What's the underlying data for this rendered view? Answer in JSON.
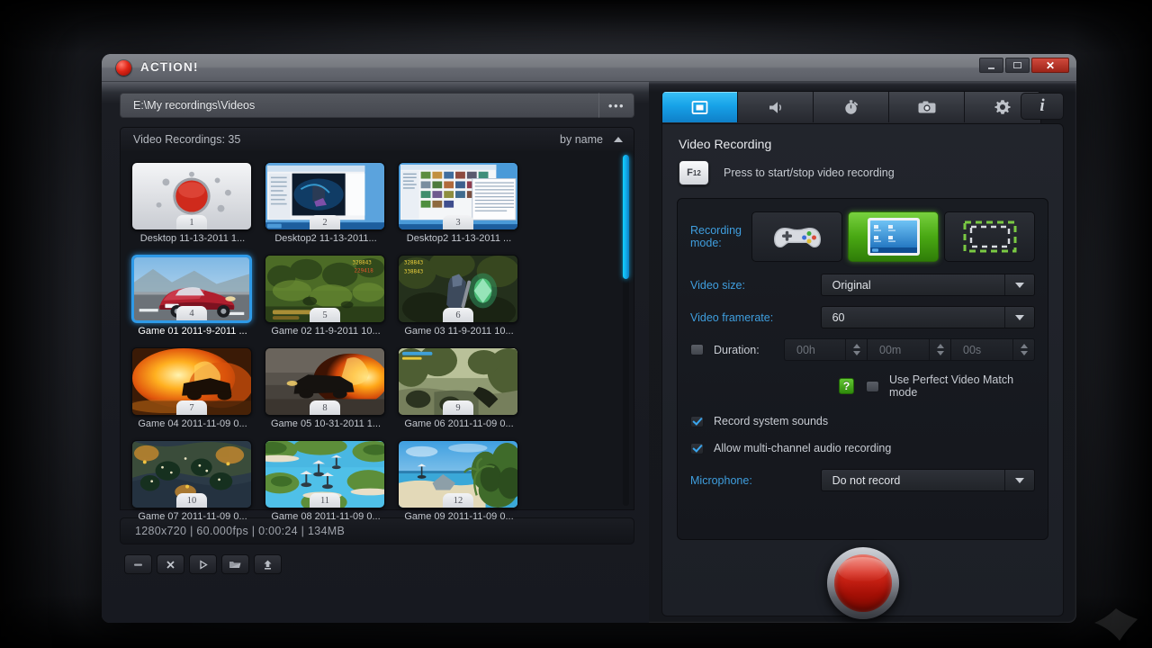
{
  "window": {
    "title": "ACTION!",
    "logo_icon": "record-dot-icon",
    "controls": {
      "minimize": "minimize-icon",
      "maximize": "maximize-icon",
      "close": "✕"
    }
  },
  "left": {
    "path": {
      "value": "E:\\My recordings\\Videos",
      "browse_label": "•••"
    },
    "list_header": {
      "title": "Video Recordings: 35",
      "sort": "by name",
      "sort_dir_icon": "chevron-up-icon"
    },
    "thumbnails": [
      {
        "num": "1",
        "label": "Desktop 11-13-2011 1...",
        "art": "record",
        "selected": false
      },
      {
        "num": "2",
        "label": "Desktop2  11-13-2011...",
        "art": "desktop1",
        "selected": false
      },
      {
        "num": "3",
        "label": "Desktop2 11-13-2011 ...",
        "art": "desktop2",
        "selected": false
      },
      {
        "num": "4",
        "label": "Game 01 2011-9-2011 ...",
        "art": "car",
        "selected": true
      },
      {
        "num": "5",
        "label": "Game 02 11-9-2011 10...",
        "art": "forest",
        "selected": false
      },
      {
        "num": "6",
        "label": "Game 03 11-9-2011 10...",
        "art": "knight",
        "selected": false
      },
      {
        "num": "7",
        "label": "Game 04 2011-11-09 0...",
        "art": "fire1",
        "selected": false
      },
      {
        "num": "8",
        "label": "Game 05 10-31-2011 1...",
        "art": "fire2",
        "selected": false
      },
      {
        "num": "9",
        "label": "Game 06 2011-11-09 0...",
        "art": "jungle",
        "selected": false
      },
      {
        "num": "10",
        "label": "Game 07 2011-11-09 0...",
        "art": "rts",
        "selected": false
      },
      {
        "num": "11",
        "label": "Game 08 2011-11-09 0...",
        "art": "islands",
        "selected": false
      },
      {
        "num": "12",
        "label": "Game 09 2011-11-09 0...",
        "art": "beach",
        "selected": false
      }
    ],
    "status": "1280x720 | 60.000fps | 0:00:24 | 134MB",
    "tools": [
      {
        "name": "remove-button",
        "icon": "minus-icon"
      },
      {
        "name": "delete-button",
        "icon": "close-icon"
      },
      {
        "name": "play-button",
        "icon": "play-icon"
      },
      {
        "name": "folder-button",
        "icon": "folder-icon"
      },
      {
        "name": "upload-button",
        "icon": "upload-icon"
      }
    ]
  },
  "right": {
    "tabs": [
      {
        "label": "Video Recording",
        "icon": "film-icon",
        "active": true
      },
      {
        "label": "Audio Recording",
        "icon": "speaker-icon",
        "active": false
      },
      {
        "label": "Benchmark",
        "icon": "stopwatch-icon",
        "active": false
      },
      {
        "label": "Screenshot",
        "icon": "camera-icon",
        "active": false
      },
      {
        "label": "Settings",
        "icon": "gear-icon",
        "active": false
      }
    ],
    "info_button": "i",
    "section_title": "Video Recording",
    "hotkey": {
      "key": "F12",
      "key_main": "F",
      "key_sub": "12",
      "text": "Press to start/stop video recording"
    },
    "settings": {
      "recording_mode": {
        "label": "Recording mode:",
        "options": [
          {
            "name": "games-mode",
            "icon": "gamepad-icon",
            "active": false
          },
          {
            "name": "desktop-mode",
            "icon": "monitor-icon",
            "active": true
          },
          {
            "name": "region-mode",
            "icon": "selection-region-icon",
            "active": false
          }
        ]
      },
      "video_size": {
        "label": "Video size:",
        "value": "Original"
      },
      "video_framerate": {
        "label": "Video framerate:",
        "value": "60"
      },
      "duration": {
        "label": "Duration:",
        "checked": false,
        "hours": "00h",
        "minutes": "00m",
        "seconds": "00s"
      },
      "perfect_match": {
        "label": "Use Perfect Video Match mode",
        "checked": false,
        "help": "?"
      },
      "record_system_sounds": {
        "label": "Record system sounds",
        "checked": true
      },
      "multi_channel_audio": {
        "label": "Allow multi-channel audio recording",
        "checked": true
      },
      "microphone": {
        "label": "Microphone:",
        "value": "Do not record"
      }
    },
    "record_button": "record-button"
  },
  "colors": {
    "accent_blue": "#3f9ede",
    "tab_active": "#17a2e8",
    "mode_active_green": "#49a813",
    "record_red": "#d6281a",
    "scrollbar": "#13a6e8"
  }
}
